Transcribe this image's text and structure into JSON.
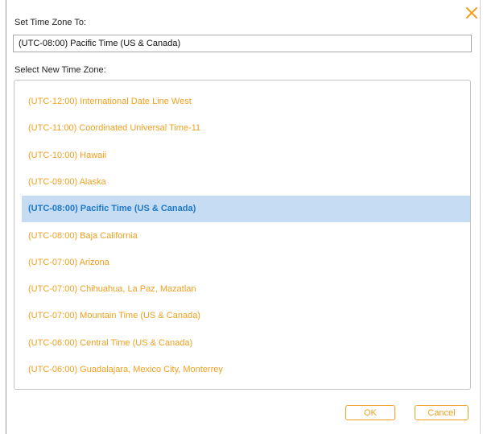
{
  "dialog": {
    "set_label": "Set Time Zone To:",
    "current_value": "(UTC-08:00) Pacific Time (US & Canada)",
    "select_label": "Select New Time Zone:",
    "close_icon": "close-x-icon",
    "accent_color": "#f0a020",
    "selected_bg": "#c5dcf3",
    "selected_text_color": "#1e78c8",
    "timezones": [
      "(UTC-12:00) International Date Line West",
      "(UTC-11:00) Coordinated Universal Time-11",
      "(UTC-10:00) Hawaii",
      "(UTC-09:00) Alaska",
      "(UTC-08:00) Pacific Time (US & Canada)",
      "(UTC-08:00) Baja California",
      "(UTC-07:00) Arizona",
      "(UTC-07:00) Chihuahua, La Paz, Mazatlan",
      "(UTC-07:00) Mountain Time (US & Canada)",
      "(UTC-06:00) Central Time (US & Canada)",
      "(UTC-06:00) Guadalajara, Mexico City, Monterrey"
    ],
    "selected_index": 4,
    "ok_label": "OK",
    "cancel_label": "Cancel"
  }
}
